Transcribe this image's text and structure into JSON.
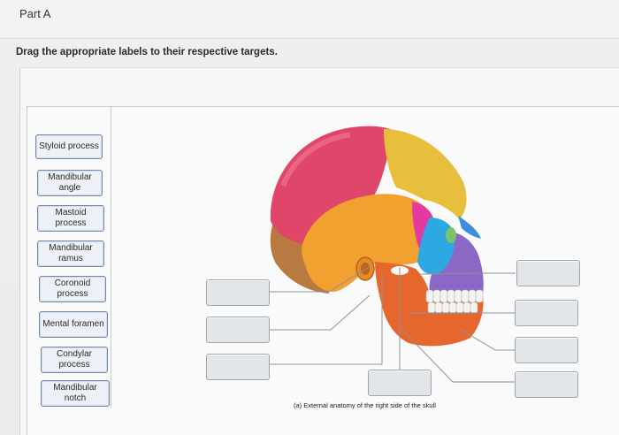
{
  "header": {
    "part_title": "Part A"
  },
  "instructions": "Drag the appropriate labels to their respective targets.",
  "labels": [
    "Styloid process",
    "Mandibular angle",
    "Mastoid process",
    "Mandibular ramus",
    "Coronoid process",
    "Mental foramen",
    "Condylar process",
    "Mandibular notch"
  ],
  "figure": {
    "caption": "(a) External anatomy of the right side of the skull",
    "bone_colors": {
      "parietal": "#e0466a",
      "frontal": "#e7bf3c",
      "temporal": "#f2a030",
      "occipital": "#b87a40",
      "sphenoid": "#e23aa0",
      "zygomatic": "#2ea8e0",
      "maxilla": "#8b67c6",
      "mandible": "#e5672e",
      "nasal": "#3a8fd8"
    },
    "label_chip_border": "#6f88ab",
    "drop_target_fill": "#e3e6e9"
  }
}
